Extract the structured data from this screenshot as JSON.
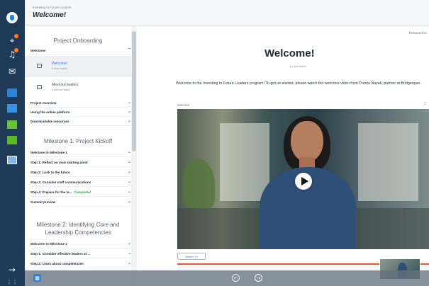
{
  "header": {
    "breadcrumb": "Investing in Future Leaders",
    "title": "Welcome!"
  },
  "sidebar": {
    "section1_title": "Project Onboarding",
    "welcome_row": "Welcome!",
    "sub_items": [
      {
        "title": "Welcome!",
        "meta": "8 mins watch"
      },
      {
        "title": "Meet our leaders",
        "meta": "5 mins of watch"
      }
    ],
    "rows_a": [
      "Project overview",
      "Using the online platform",
      "Downloadable resources"
    ],
    "section2_title": "Milestone 1: Project Kickoff",
    "rows_b": [
      "Welcome to Milestone 1",
      "Step 1: Reflect on your starting point",
      "Step 2: Look to the future",
      "Step 3: Consider staff communications",
      "Step 4: Prepare for the la...",
      "Summit preview"
    ],
    "completed_label": "Completed",
    "section3_title": "Milestone 2: Identifying Core and Leadership Competencies",
    "rows_c": [
      "Welcome to Milestone 2",
      "Step 1: Consider effective leaders at ...",
      "Step 2: Learn about competencies"
    ]
  },
  "main": {
    "released": "Released on",
    "title": "Welcome!",
    "watch_meta": "8 mins watch",
    "intro": "Welcome to the Investing in Future Leaders program! To get us started, please watch the welcome video from Preeta Nayak, partner at Bridgespan.",
    "video_label": "Welcome",
    "speed": "Speed: 1x"
  }
}
